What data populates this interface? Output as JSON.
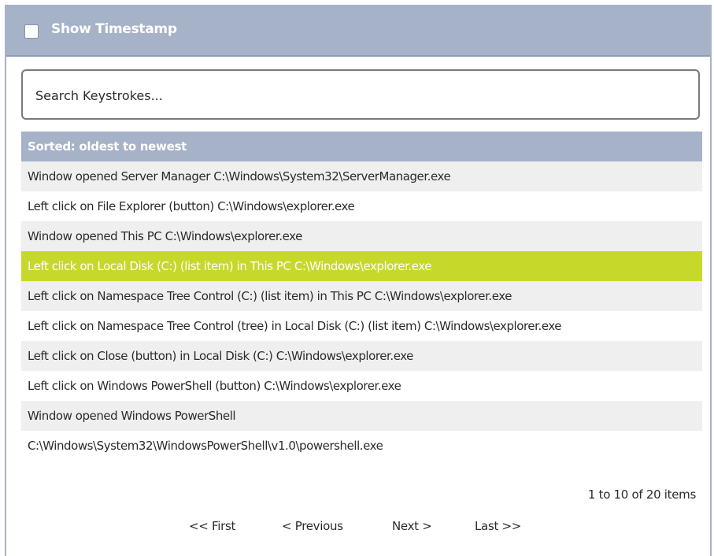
{
  "header": {
    "checkbox_label": "Show Timestamp"
  },
  "search": {
    "placeholder": "Search Keystrokes..."
  },
  "sort": {
    "label": "Sorted: oldest to newest"
  },
  "rows": [
    {
      "text": "Window opened Server Manager C:\\Windows\\System32\\ServerManager.exe",
      "selected": false
    },
    {
      "text": "Left click on File Explorer (button) C:\\Windows\\explorer.exe",
      "selected": false
    },
    {
      "text": "Window opened This PC C:\\Windows\\explorer.exe",
      "selected": false
    },
    {
      "text": "Left click on Local Disk (C:) (list item) in This PC C:\\Windows\\explorer.exe",
      "selected": true
    },
    {
      "text": "Left click on Namespace Tree Control (C:) (list item) in This PC C:\\Windows\\explorer.exe",
      "selected": false
    },
    {
      "text": "Left click on Namespace Tree Control (tree) in Local Disk (C:) (list item) C:\\Windows\\explorer.exe",
      "selected": false
    },
    {
      "text": "Left click on Close (button) in Local Disk (C:) C:\\Windows\\explorer.exe",
      "selected": false
    },
    {
      "text": "Left click on Windows PowerShell (button) C:\\Windows\\explorer.exe",
      "selected": false
    },
    {
      "text": "Window opened Windows PowerShell",
      "selected": false
    },
    {
      "text": "C:\\Windows\\System32\\WindowsPowerShell\\v1.0\\powershell.exe",
      "selected": false
    }
  ],
  "pagination": {
    "count": "1 to 10 of 20 items",
    "first": "<< First",
    "previous": "< Previous",
    "next": "Next >",
    "last": "Last >>"
  },
  "colors": {
    "header_bg": "#a5b2c8",
    "row_alt": "#efefef",
    "selected": "#c6d92a"
  }
}
